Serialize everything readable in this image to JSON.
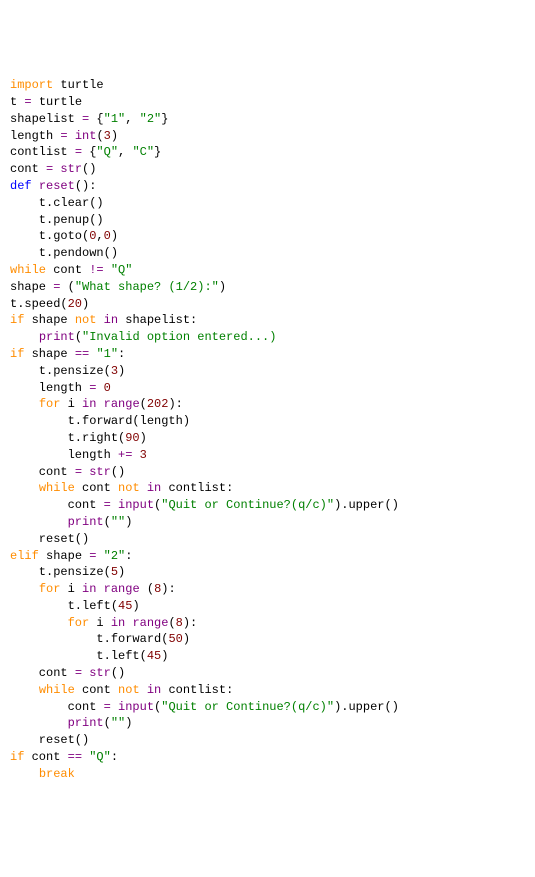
{
  "lines": [
    [
      {
        "t": "import ",
        "c": "kw-import"
      },
      {
        "t": "turtle",
        "c": "id"
      }
    ],
    [
      {
        "t": "",
        "c": "id"
      }
    ],
    [
      {
        "t": "t ",
        "c": "id"
      },
      {
        "t": "= ",
        "c": "op"
      },
      {
        "t": "turtle",
        "c": "id"
      }
    ],
    [
      {
        "t": "shapelist ",
        "c": "id"
      },
      {
        "t": "= ",
        "c": "op"
      },
      {
        "t": "{",
        "c": "paren"
      },
      {
        "t": "\"1\"",
        "c": "str"
      },
      {
        "t": ", ",
        "c": "id"
      },
      {
        "t": "\"2\"",
        "c": "str"
      },
      {
        "t": "}",
        "c": "paren"
      }
    ],
    [
      {
        "t": "length ",
        "c": "id"
      },
      {
        "t": "= ",
        "c": "op"
      },
      {
        "t": "int",
        "c": "fn"
      },
      {
        "t": "(",
        "c": "paren"
      },
      {
        "t": "3",
        "c": "num"
      },
      {
        "t": ")",
        "c": "paren"
      }
    ],
    [
      {
        "t": "contlist ",
        "c": "id"
      },
      {
        "t": "= ",
        "c": "op"
      },
      {
        "t": "{",
        "c": "paren"
      },
      {
        "t": "\"Q\"",
        "c": "str"
      },
      {
        "t": ", ",
        "c": "id"
      },
      {
        "t": "\"C\"",
        "c": "str"
      },
      {
        "t": "}",
        "c": "paren"
      }
    ],
    [
      {
        "t": "cont ",
        "c": "id"
      },
      {
        "t": "= ",
        "c": "op"
      },
      {
        "t": "str",
        "c": "fn"
      },
      {
        "t": "()",
        "c": "paren"
      }
    ],
    [
      {
        "t": "",
        "c": "id"
      }
    ],
    [
      {
        "t": "def ",
        "c": "kw-def"
      },
      {
        "t": "reset",
        "c": "fn"
      },
      {
        "t": "():",
        "c": "paren"
      }
    ],
    [
      {
        "t": "    t.clear()",
        "c": "id"
      }
    ],
    [
      {
        "t": "    t.penup()",
        "c": "id"
      }
    ],
    [
      {
        "t": "    t.goto(",
        "c": "id"
      },
      {
        "t": "0",
        "c": "num"
      },
      {
        "t": ",",
        "c": "id"
      },
      {
        "t": "0",
        "c": "num"
      },
      {
        "t": ")",
        "c": "paren"
      }
    ],
    [
      {
        "t": "    t.pendown()",
        "c": "id"
      }
    ],
    [
      {
        "t": "",
        "c": "id"
      }
    ],
    [
      {
        "t": "while ",
        "c": "kw-flow"
      },
      {
        "t": "cont ",
        "c": "id"
      },
      {
        "t": "!= ",
        "c": "op"
      },
      {
        "t": "\"Q\"",
        "c": "str"
      }
    ],
    [
      {
        "t": "shape ",
        "c": "id"
      },
      {
        "t": "= ",
        "c": "op"
      },
      {
        "t": "(",
        "c": "paren"
      },
      {
        "t": "\"What shape? (1/2):\"",
        "c": "str"
      },
      {
        "t": ")",
        "c": "paren"
      }
    ],
    [
      {
        "t": "t.speed(",
        "c": "id"
      },
      {
        "t": "20",
        "c": "num"
      },
      {
        "t": ")",
        "c": "paren"
      }
    ],
    [
      {
        "t": "if ",
        "c": "kw-flow"
      },
      {
        "t": "shape ",
        "c": "id"
      },
      {
        "t": "not ",
        "c": "kw-not"
      },
      {
        "t": "in ",
        "c": "kw-in"
      },
      {
        "t": "shapelist:",
        "c": "id"
      }
    ],
    [
      {
        "t": "    ",
        "c": "id"
      },
      {
        "t": "print",
        "c": "fn"
      },
      {
        "t": "(",
        "c": "paren"
      },
      {
        "t": "\"Invalid option entered...)",
        "c": "str"
      }
    ],
    [
      {
        "t": "if ",
        "c": "kw-flow"
      },
      {
        "t": "shape ",
        "c": "id"
      },
      {
        "t": "== ",
        "c": "op"
      },
      {
        "t": "\"1\"",
        "c": "str"
      },
      {
        "t": ":",
        "c": "id"
      }
    ],
    [
      {
        "t": "    t.pensize(",
        "c": "id"
      },
      {
        "t": "3",
        "c": "num"
      },
      {
        "t": ")",
        "c": "paren"
      }
    ],
    [
      {
        "t": "    length ",
        "c": "id"
      },
      {
        "t": "= ",
        "c": "op"
      },
      {
        "t": "0",
        "c": "num"
      }
    ],
    [
      {
        "t": "    ",
        "c": "id"
      },
      {
        "t": "for ",
        "c": "kw-flow"
      },
      {
        "t": "i ",
        "c": "id"
      },
      {
        "t": "in ",
        "c": "kw-in"
      },
      {
        "t": "range",
        "c": "fn"
      },
      {
        "t": "(",
        "c": "paren"
      },
      {
        "t": "202",
        "c": "num"
      },
      {
        "t": "):",
        "c": "paren"
      }
    ],
    [
      {
        "t": "        t.forward(length)",
        "c": "id"
      }
    ],
    [
      {
        "t": "        t.right(",
        "c": "id"
      },
      {
        "t": "90",
        "c": "num"
      },
      {
        "t": ")",
        "c": "paren"
      }
    ],
    [
      {
        "t": "        length ",
        "c": "id"
      },
      {
        "t": "+= ",
        "c": "op"
      },
      {
        "t": "3",
        "c": "num"
      }
    ],
    [
      {
        "t": "    cont ",
        "c": "id"
      },
      {
        "t": "= ",
        "c": "op"
      },
      {
        "t": "str",
        "c": "fn"
      },
      {
        "t": "()",
        "c": "paren"
      }
    ],
    [
      {
        "t": "    ",
        "c": "id"
      },
      {
        "t": "while ",
        "c": "kw-flow"
      },
      {
        "t": "cont ",
        "c": "id"
      },
      {
        "t": "not ",
        "c": "kw-not"
      },
      {
        "t": "in ",
        "c": "kw-in"
      },
      {
        "t": "contlist:",
        "c": "id"
      }
    ],
    [
      {
        "t": "        cont ",
        "c": "id"
      },
      {
        "t": "= ",
        "c": "op"
      },
      {
        "t": "input",
        "c": "fn"
      },
      {
        "t": "(",
        "c": "paren"
      },
      {
        "t": "\"Quit or Continue?(q/c)\"",
        "c": "str"
      },
      {
        "t": ").upper()",
        "c": "id"
      }
    ],
    [
      {
        "t": "        ",
        "c": "id"
      },
      {
        "t": "print",
        "c": "fn"
      },
      {
        "t": "(",
        "c": "paren"
      },
      {
        "t": "\"\"",
        "c": "str"
      },
      {
        "t": ")",
        "c": "paren"
      }
    ],
    [
      {
        "t": "    reset()",
        "c": "id"
      }
    ],
    [
      {
        "t": "elif ",
        "c": "kw-flow"
      },
      {
        "t": "shape ",
        "c": "id"
      },
      {
        "t": "= ",
        "c": "op"
      },
      {
        "t": "\"2\"",
        "c": "str"
      },
      {
        "t": ":",
        "c": "id"
      }
    ],
    [
      {
        "t": "    t.pensize(",
        "c": "id"
      },
      {
        "t": "5",
        "c": "num"
      },
      {
        "t": ")",
        "c": "paren"
      }
    ],
    [
      {
        "t": "    ",
        "c": "id"
      },
      {
        "t": "for ",
        "c": "kw-flow"
      },
      {
        "t": "i ",
        "c": "id"
      },
      {
        "t": "in ",
        "c": "kw-in"
      },
      {
        "t": "range ",
        "c": "fn"
      },
      {
        "t": "(",
        "c": "paren"
      },
      {
        "t": "8",
        "c": "num"
      },
      {
        "t": "):",
        "c": "paren"
      }
    ],
    [
      {
        "t": "        t.left(",
        "c": "id"
      },
      {
        "t": "45",
        "c": "num"
      },
      {
        "t": ")",
        "c": "paren"
      }
    ],
    [
      {
        "t": "        ",
        "c": "id"
      },
      {
        "t": "for ",
        "c": "kw-flow"
      },
      {
        "t": "i ",
        "c": "id"
      },
      {
        "t": "in ",
        "c": "kw-in"
      },
      {
        "t": "range",
        "c": "fn"
      },
      {
        "t": "(",
        "c": "paren"
      },
      {
        "t": "8",
        "c": "num"
      },
      {
        "t": "):",
        "c": "paren"
      }
    ],
    [
      {
        "t": "            t.forward(",
        "c": "id"
      },
      {
        "t": "50",
        "c": "num"
      },
      {
        "t": ")",
        "c": "paren"
      }
    ],
    [
      {
        "t": "            t.left(",
        "c": "id"
      },
      {
        "t": "45",
        "c": "num"
      },
      {
        "t": ")",
        "c": "paren"
      }
    ],
    [
      {
        "t": "    cont ",
        "c": "id"
      },
      {
        "t": "= ",
        "c": "op"
      },
      {
        "t": "str",
        "c": "fn"
      },
      {
        "t": "()",
        "c": "paren"
      }
    ],
    [
      {
        "t": "    ",
        "c": "id"
      },
      {
        "t": "while ",
        "c": "kw-flow"
      },
      {
        "t": "cont ",
        "c": "id"
      },
      {
        "t": "not ",
        "c": "kw-not"
      },
      {
        "t": "in ",
        "c": "kw-in"
      },
      {
        "t": "contlist:",
        "c": "id"
      }
    ],
    [
      {
        "t": "        cont ",
        "c": "id"
      },
      {
        "t": "= ",
        "c": "op"
      },
      {
        "t": "input",
        "c": "fn"
      },
      {
        "t": "(",
        "c": "paren"
      },
      {
        "t": "\"Quit or Continue?(q/c)\"",
        "c": "str"
      },
      {
        "t": ").upper()",
        "c": "id"
      }
    ],
    [
      {
        "t": "        ",
        "c": "id"
      },
      {
        "t": "print",
        "c": "fn"
      },
      {
        "t": "(",
        "c": "paren"
      },
      {
        "t": "\"\"",
        "c": "str"
      },
      {
        "t": ")",
        "c": "paren"
      }
    ],
    [
      {
        "t": "    reset()",
        "c": "id"
      }
    ],
    [
      {
        "t": "if ",
        "c": "kw-flow"
      },
      {
        "t": "cont ",
        "c": "id"
      },
      {
        "t": "== ",
        "c": "op"
      },
      {
        "t": "\"Q\"",
        "c": "str"
      },
      {
        "t": ":",
        "c": "id"
      }
    ],
    [
      {
        "t": "    ",
        "c": "id"
      },
      {
        "t": "break",
        "c": "kw-flow"
      }
    ]
  ]
}
